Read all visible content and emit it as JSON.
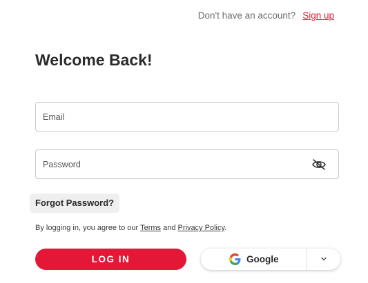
{
  "header": {
    "prompt": "Don't have an account?",
    "signup_label": "Sign up"
  },
  "title": "Welcome Back!",
  "form": {
    "email_label": "Email",
    "email_value": "",
    "password_label": "Password",
    "password_value": "",
    "forgot_label": "Forgot Password?"
  },
  "terms": {
    "prefix": "By logging in, you agree to our ",
    "terms_label": "Terms",
    "and": " and ",
    "privacy_label": "Privacy Policy",
    "suffix": "."
  },
  "actions": {
    "login_label": "LOG IN",
    "google_label": "Google"
  },
  "icons": {
    "password_toggle": "eye-off-icon",
    "google": "google-g-icon",
    "dropdown": "chevron-down-icon"
  },
  "colors": {
    "accent": "#e31837",
    "text": "#2a2a2a",
    "border": "#c9c9c9"
  }
}
